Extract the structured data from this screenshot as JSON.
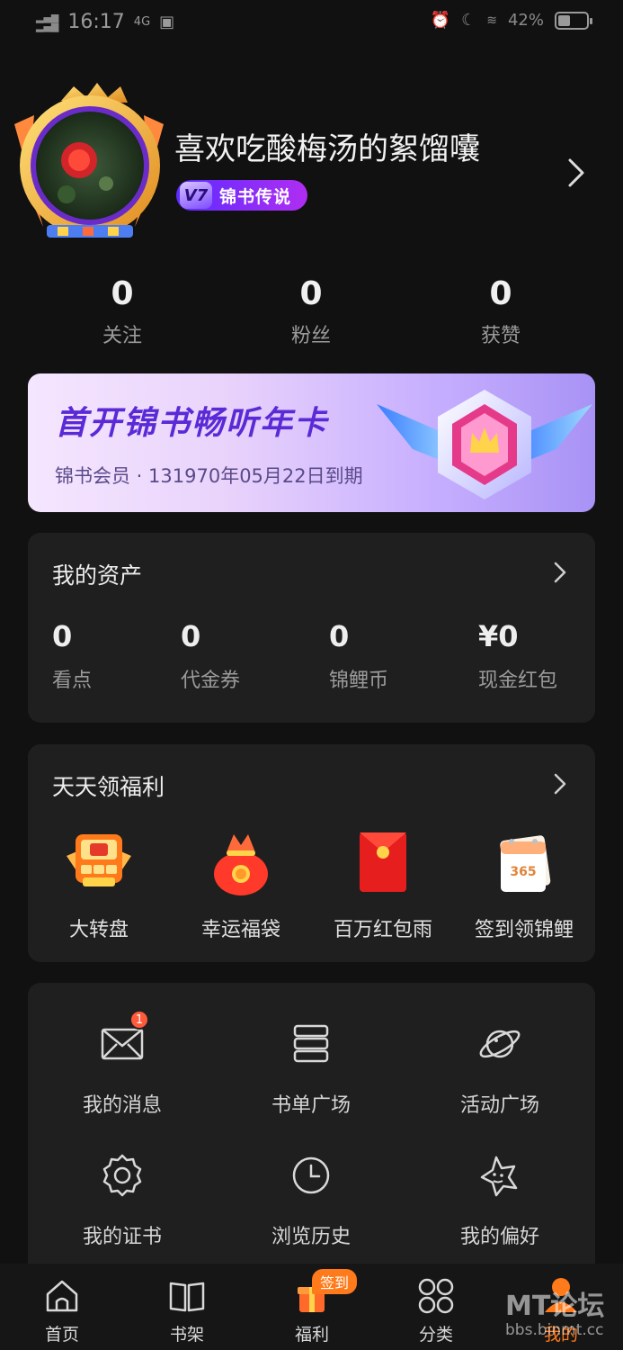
{
  "status_bar": {
    "time": "16:17",
    "network": "4G",
    "battery": "42%",
    "battery_level": 0.42
  },
  "profile": {
    "username": "喜欢吃酸梅汤的絮馏囔",
    "vip_level": "V7",
    "vip_title": "锦书传说"
  },
  "stats": [
    {
      "value": "0",
      "label": "关注"
    },
    {
      "value": "0",
      "label": "粉丝"
    },
    {
      "value": "0",
      "label": "获赞"
    }
  ],
  "banner": {
    "title": "首开锦书畅听年卡",
    "subtitle": "锦书会员 · 131970年05月22日到期"
  },
  "assets": {
    "title": "我的资产",
    "items": [
      {
        "value": "0",
        "label": "看点"
      },
      {
        "value": "0",
        "label": "代金券"
      },
      {
        "value": "0",
        "label": "锦鲤币"
      },
      {
        "value": "¥0",
        "label": "现金红包"
      }
    ]
  },
  "welfare": {
    "title": "天天领福利",
    "items": [
      {
        "label": "大转盘",
        "icon": "prize-wheel-icon"
      },
      {
        "label": "幸运福袋",
        "icon": "lucky-bag-icon"
      },
      {
        "label": "百万红包雨",
        "icon": "red-envelope-icon"
      },
      {
        "label": "签到领锦鲤",
        "icon": "calendar-icon",
        "icon_text": "365"
      }
    ]
  },
  "tools": [
    {
      "label": "我的消息",
      "icon": "mail-icon",
      "badge": "1"
    },
    {
      "label": "书单广场",
      "icon": "booklist-icon"
    },
    {
      "label": "活动广场",
      "icon": "planet-icon"
    },
    {
      "label": "我的证书",
      "icon": "certificate-icon"
    },
    {
      "label": "浏览历史",
      "icon": "clock-icon"
    },
    {
      "label": "我的偏好",
      "icon": "star-face-icon"
    }
  ],
  "nav": {
    "items": [
      {
        "label": "首页",
        "icon": "home-icon"
      },
      {
        "label": "书架",
        "icon": "book-icon"
      },
      {
        "label": "福利",
        "icon": "gift-icon",
        "badge": "签到"
      },
      {
        "label": "分类",
        "icon": "grid-icon"
      },
      {
        "label": "我的",
        "icon": "profile-icon",
        "active": true
      }
    ]
  },
  "watermark": {
    "big": "MT论坛",
    "small": "bbs.binmt.cc"
  },
  "colors": {
    "accent": "#ff7a1a",
    "background": "#111111",
    "card": "#1f1f1f",
    "banner_text": "#5a2ad6"
  }
}
